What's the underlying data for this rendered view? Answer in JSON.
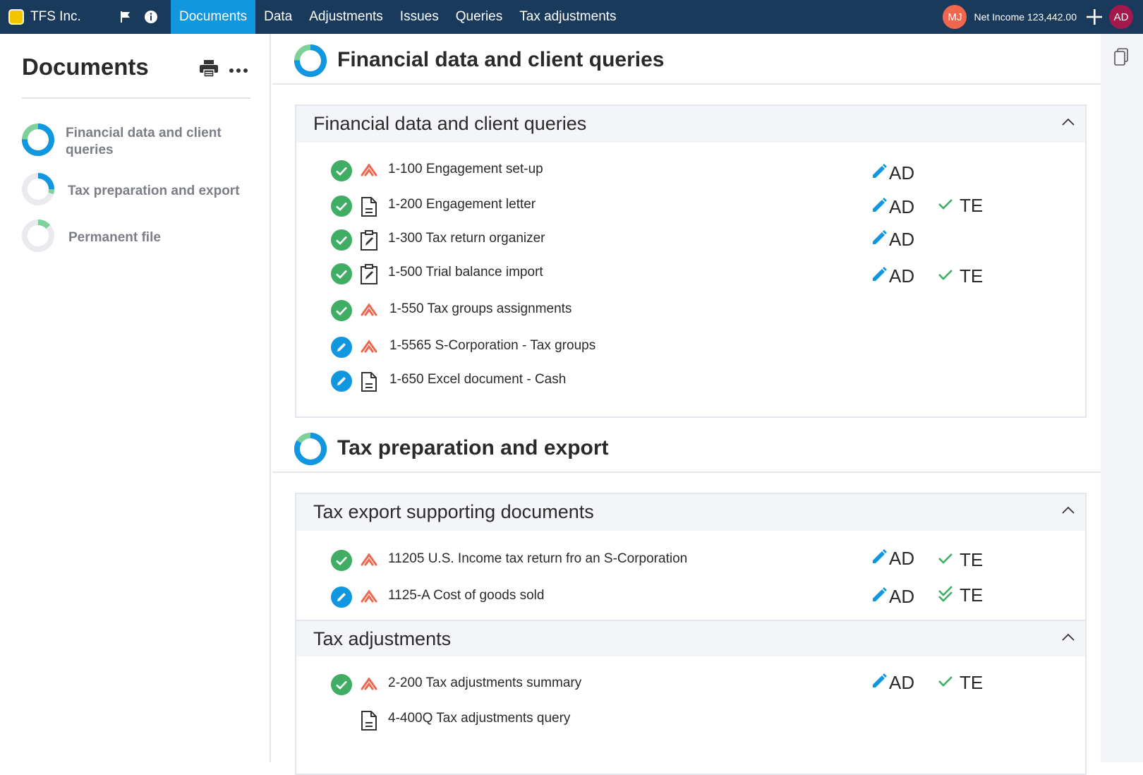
{
  "app": {
    "company": "TFS Inc."
  },
  "nav": {
    "items": [
      "Documents",
      "Data",
      "Adjustments",
      "Issues",
      "Queries",
      "Tax adjustments"
    ],
    "active_index": 0
  },
  "topbar": {
    "avatar_left": "MJ",
    "net_income": "Net Income 123,442.00",
    "avatar_right": "AD"
  },
  "sidebar": {
    "title": "Documents",
    "items": [
      {
        "label": "Financial data and client queries"
      },
      {
        "label": "Tax preparation and export"
      },
      {
        "label": "Permanent file"
      }
    ]
  },
  "sections": [
    {
      "title": "Financial data and client queries",
      "groups": [
        {
          "title": "Financial data and client queries",
          "rows": [
            {
              "label": "1-100 Engagement set-up",
              "status": "complete",
              "type": "query",
              "sig1": "AD",
              "sig2": ""
            },
            {
              "label": "1-200 Engagement letter",
              "status": "complete",
              "type": "document",
              "sig1": "AD",
              "sig2": "TE"
            },
            {
              "label": "1-300 Tax return organizer",
              "status": "complete",
              "type": "form",
              "sig1": "AD",
              "sig2": ""
            },
            {
              "label": "1-500 Trial balance import",
              "status": "complete",
              "type": "form",
              "sig1": "AD",
              "sig2": "TE"
            },
            {
              "label": "1-550 Tax groups assignments",
              "status": "complete",
              "type": "query",
              "sig1": "",
              "sig2": ""
            },
            {
              "label": "1-5565 S-Corporation - Tax groups",
              "status": "in-progress",
              "type": "query",
              "sig1": "",
              "sig2": ""
            },
            {
              "label": "1-650 Excel document - Cash",
              "status": "in-progress",
              "type": "document",
              "sig1": "",
              "sig2": ""
            }
          ]
        }
      ]
    },
    {
      "title": "Tax preparation and export",
      "groups": [
        {
          "title": "Tax export supporting documents",
          "rows": [
            {
              "label": "11205 U.S. Income tax return fro an S-Corporation",
              "status": "complete",
              "type": "query",
              "sig1": "AD",
              "sig2": "TE"
            },
            {
              "label": "1125-A Cost of goods sold",
              "status": "in-progress",
              "type": "query",
              "sig1": "AD",
              "sig2": "TE"
            }
          ]
        },
        {
          "title": "Tax adjustments",
          "rows": [
            {
              "label": "2-200 Tax adjustments summary",
              "status": "complete",
              "type": "query",
              "sig1": "AD",
              "sig2": "TE"
            },
            {
              "label": "4-400Q Tax adjustments query",
              "status": "none",
              "type": "document",
              "sig1": "",
              "sig2": ""
            }
          ]
        }
      ]
    }
  ],
  "colors": {
    "topbar": "#1a3a5c",
    "active_tab": "#1196e0",
    "complete": "#3fae64",
    "in_progress": "#1196e0",
    "query_icon": "#f0674f",
    "donut_blue": "#1196e0",
    "donut_green": "#7fd19a"
  }
}
